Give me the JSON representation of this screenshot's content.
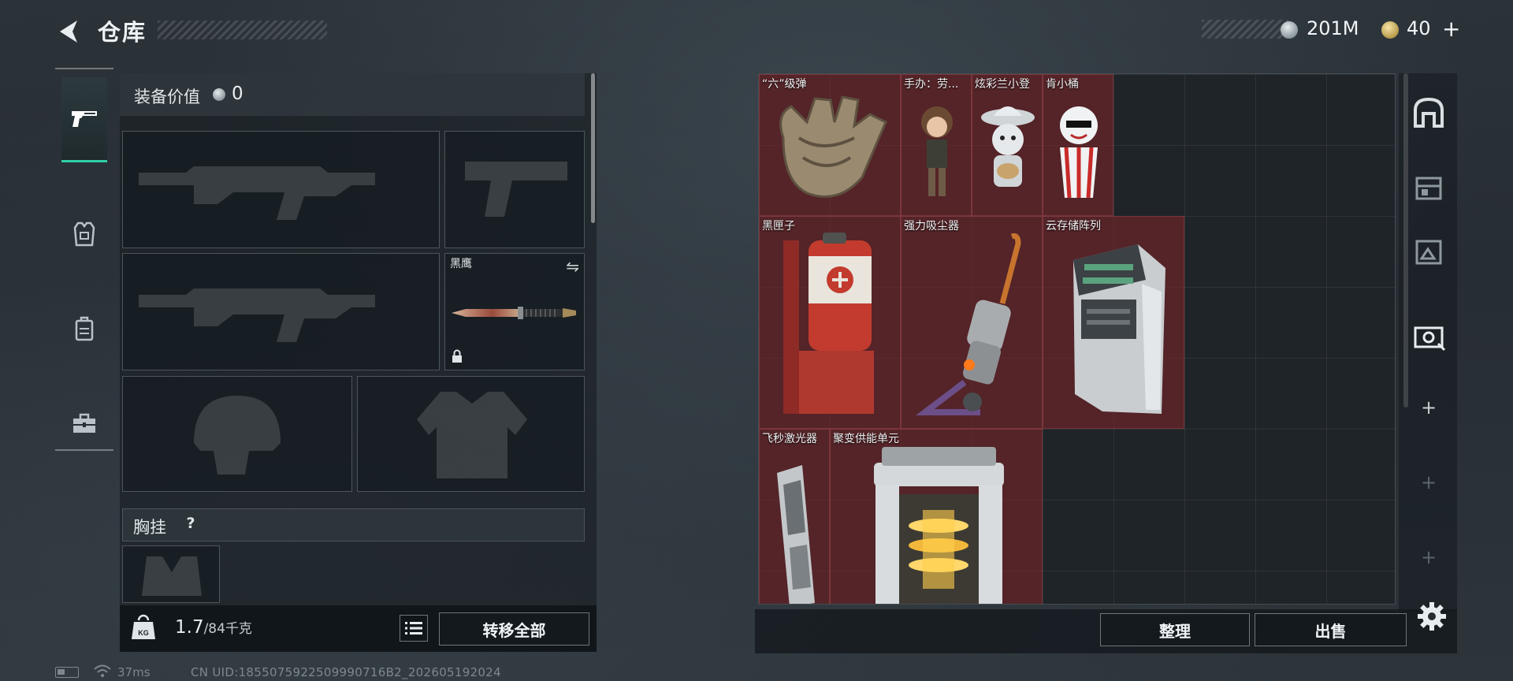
{
  "header": {
    "title": "仓库",
    "currency_main": "201M",
    "currency_secondary": "40",
    "add_symbol": "+"
  },
  "equipment": {
    "value_label": "装备价值",
    "value": "0",
    "melee_name": "黑鹰",
    "chest_label": "胸挂",
    "chest_help": "?",
    "weight_current": "1.7",
    "weight_max": "/84千克",
    "weight_icon_text": "KG",
    "transfer_all": "转移全部"
  },
  "storage": {
    "items": [
      {
        "name": "“六”级弹"
      },
      {
        "name": "手办：劳..."
      },
      {
        "name": "炫彩兰小登"
      },
      {
        "name": "肯小桶"
      },
      {
        "name": "黑匣子"
      },
      {
        "name": "强力吸尘器"
      },
      {
        "name": "云存储阵列"
      },
      {
        "name": "飞秒激光器"
      },
      {
        "name": "聚变供能单元"
      }
    ],
    "sort_label": "整理",
    "sell_label": "出售"
  },
  "status": {
    "ping": "37ms",
    "uid": "CN UID:1855075922509990716B2_202605192024"
  },
  "colors": {
    "accent": "#2fd0a8",
    "item_bg": "#78242899",
    "panel_border": "#4a555c"
  },
  "icons": {
    "back": "back-arrow-icon",
    "weapon_tab": "pistol-icon",
    "armor_tab": "armor-icon",
    "backpack_tab": "backpack-icon",
    "case_tab": "toolbox-icon",
    "settings": "gear-icon"
  }
}
